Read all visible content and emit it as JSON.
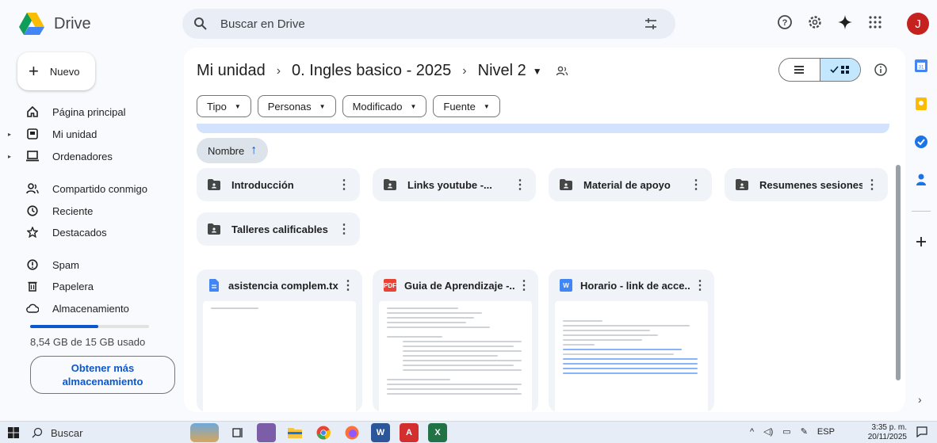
{
  "app": {
    "name": "Drive"
  },
  "search": {
    "placeholder": "Buscar en Drive"
  },
  "user": {
    "initial": "J",
    "avatar_color": "#c5221f"
  },
  "nav": {
    "new_label": "Nuevo",
    "items": [
      {
        "label": "Página principal",
        "icon": "home-icon"
      },
      {
        "label": "Mi unidad",
        "icon": "drive-icon",
        "expandable": true
      },
      {
        "label": "Ordenadores",
        "icon": "computer-icon",
        "expandable": true
      },
      {
        "label": "Compartido conmigo",
        "icon": "people-icon"
      },
      {
        "label": "Reciente",
        "icon": "clock-icon"
      },
      {
        "label": "Destacados",
        "icon": "star-icon"
      },
      {
        "label": "Spam",
        "icon": "spam-icon"
      },
      {
        "label": "Papelera",
        "icon": "trash-icon"
      },
      {
        "label": "Almacenamiento",
        "icon": "cloud-icon"
      }
    ],
    "storage_text": "8,54 GB de 15 GB usado",
    "storage_fraction": 0.57,
    "storage_button_line1": "Obtener más",
    "storage_button_line2": "almacenamiento"
  },
  "breadcrumb": {
    "items": [
      "Mi unidad",
      "0. Ingles basico - 2025",
      "Nivel 2"
    ]
  },
  "filters": [
    "Tipo",
    "Personas",
    "Modificado",
    "Fuente"
  ],
  "sort": {
    "label": "Nombre"
  },
  "folders": [
    "Introducción",
    "Links youtube -...",
    "Material de apoyo",
    "Resumenes sesiones",
    "Talleres calificables"
  ],
  "files": [
    {
      "name": "asistencia complem.txt",
      "type": "doc",
      "color": "#4285f4",
      "badge": ""
    },
    {
      "name": "Guia de Aprendizaje -...",
      "type": "pdf",
      "color": "#ea4335",
      "badge": "PDF"
    },
    {
      "name": "Horario - link de acce...",
      "type": "word",
      "color": "#4285f4",
      "badge": "W"
    }
  ],
  "taskbar": {
    "search_label": "Buscar",
    "lang": "ESP",
    "time": "3:35 p. m.",
    "date": "20/11/2025"
  }
}
